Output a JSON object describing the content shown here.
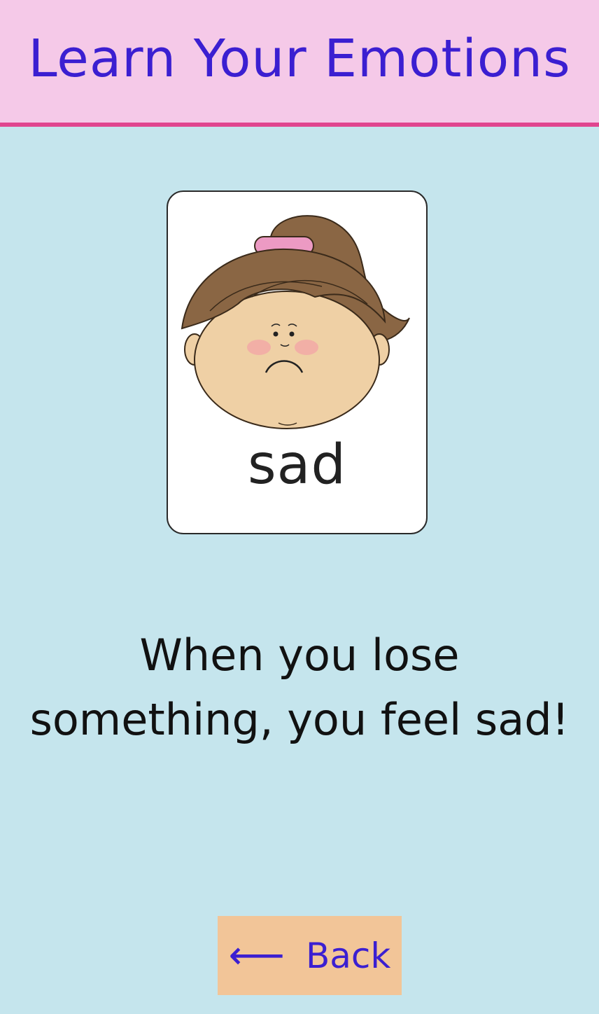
{
  "header": {
    "title": "Learn Your Emotions",
    "background": "#f5c9e8",
    "accent": "#e0458f",
    "title_color": "#3b1fd1"
  },
  "card": {
    "word": "sad",
    "illustration": "sad-girl-face"
  },
  "description": {
    "line1": "When you lose",
    "line2": "something, you feel sad!"
  },
  "back_button": {
    "arrow": "⟵",
    "label": "Back",
    "background": "#f2c598"
  },
  "page_background": "#c5e5ed"
}
